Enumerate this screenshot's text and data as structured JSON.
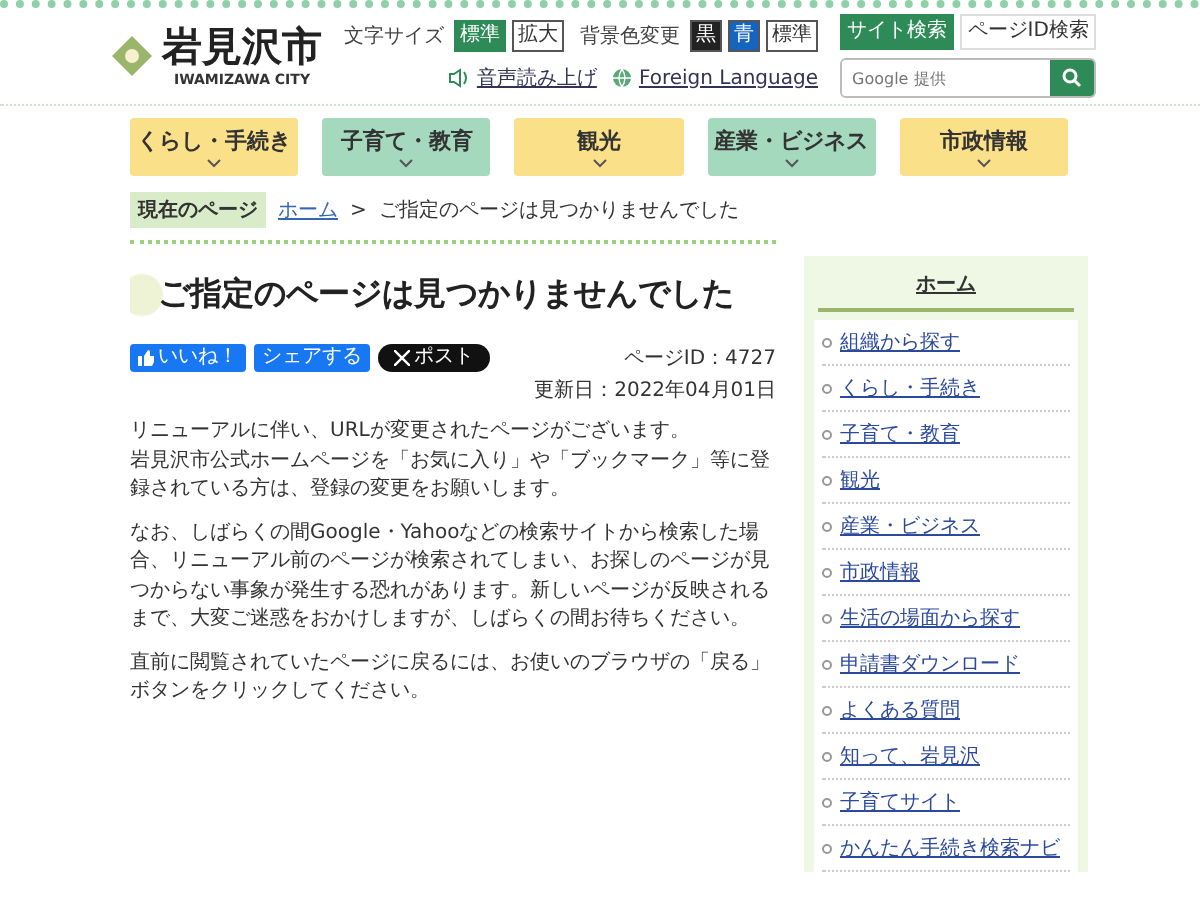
{
  "site": {
    "name": "岩見沢市",
    "name_en": "IWAMIZAWA CITY"
  },
  "text_size": {
    "label": "文字サイズ",
    "options": [
      {
        "label": "標準",
        "selected": true
      },
      {
        "label": "拡大",
        "selected": false
      }
    ]
  },
  "background": {
    "label": "背景色変更",
    "options": [
      {
        "label": "黒",
        "color": "#222222"
      },
      {
        "label": "青",
        "color": "#1565c0"
      },
      {
        "label": "標準",
        "color": "#ffffff"
      }
    ]
  },
  "links": [
    {
      "label": "音声読み上げ",
      "kind": "speaker"
    },
    {
      "label": "Foreign Language",
      "kind": "globe"
    }
  ],
  "search_tabs": [
    {
      "label": "サイト検索",
      "selected": true
    },
    {
      "label": "ページID検索",
      "selected": false
    }
  ],
  "search": {
    "placeholder": "Google 提供"
  },
  "nav": [
    {
      "label": "くらし・手続き",
      "color": "#fbe08a"
    },
    {
      "label": "子育て・教育",
      "color": "#a4d9bd"
    },
    {
      "label": "観光",
      "color": "#fbe08a"
    },
    {
      "label": "産業・ビジネス",
      "color": "#a4d9bd"
    },
    {
      "label": "市政情報",
      "color": "#fbe08a"
    }
  ],
  "breadcrumb": {
    "label": "現在のページ",
    "separator": ">",
    "items": [
      {
        "label": "ホーム",
        "kind": "link"
      },
      {
        "label": "ご指定のページは見つかりませんでした",
        "kind": "current"
      }
    ]
  },
  "main": {
    "title": "ご指定のページは見つかりませんでした",
    "social": [
      {
        "label": "いいね！",
        "kind": "like"
      },
      {
        "label": "シェアする",
        "kind": "share"
      },
      {
        "label": "ポスト",
        "kind": "x"
      }
    ],
    "page_id": "ページID：4727",
    "updated": "更新日：2022年04月01日",
    "paragraphs": [
      [
        "リニューアルに伴い、URLが変更されたページがございます。",
        "岩見沢市公式ホームページを「お気に入り」や「ブックマーク」等に登録されている方は、登録の変更をお願いします。"
      ],
      [
        "なお、しばらくの間Google・Yahooなどの検索サイトから検索した場合、リニューアル前のページが検索されてしまい、お探しのページが見つからない事象が発生する恐れがあります。新しいページが反映されるまで、大変ご迷惑をおかけしますが、しばらくの間お待ちください。"
      ],
      [
        "直前に閲覧されていたページに戻るには、お使いのブラウザの「戻る」ボタンをクリックしてください。"
      ]
    ]
  },
  "sidebar": {
    "heading": "ホーム",
    "items": [
      "組織から探す",
      "くらし・手続き",
      "子育て・教育",
      "観光",
      "産業・ビジネス",
      "市政情報",
      "生活の場面から探す",
      "申請書ダウンロード",
      "よくある質問",
      "知って、岩見沢",
      "子育てサイト",
      "かんたん手続き検索ナビ"
    ]
  }
}
